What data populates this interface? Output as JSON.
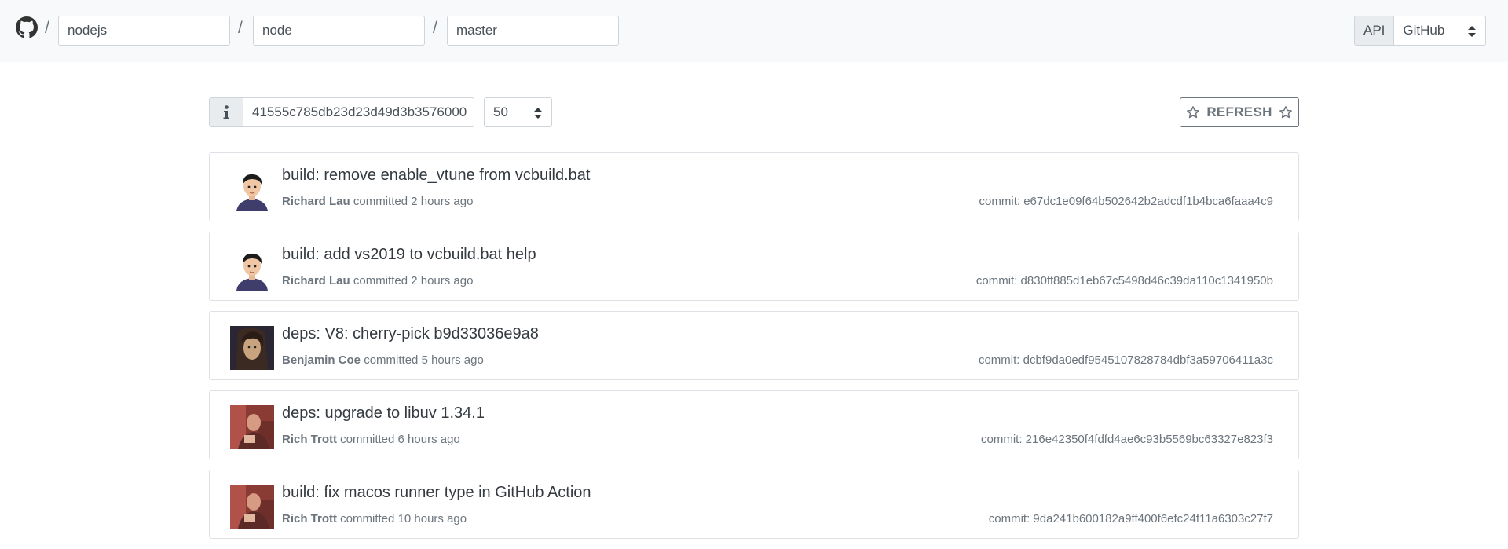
{
  "header": {
    "owner": "nodejs",
    "repo": "node",
    "branch": "master",
    "separator": "/",
    "api_label": "API",
    "api_selected": "GitHub"
  },
  "controls": {
    "sha_value": "41555c785db23d23d49d3b3576000",
    "count_selected": "50",
    "refresh_label": "REFRESH"
  },
  "commits": [
    {
      "message": "build: remove enable_vtune from vcbuild.bat",
      "author": "Richard Lau",
      "verb": "committed",
      "time": "2 hours ago",
      "sha_label": "commit: e67dc1e09f64b502642b2adcdf1b4bca6faaa4c9",
      "avatar": "cartoon"
    },
    {
      "message": "build: add vs2019 to vcbuild.bat help",
      "author": "Richard Lau",
      "verb": "committed",
      "time": "2 hours ago",
      "sha_label": "commit: d830ff885d1eb67c5498d46c39da110c1341950b",
      "avatar": "cartoon"
    },
    {
      "message": "deps: V8: cherry-pick b9d33036e9a8",
      "author": "Benjamin Coe",
      "verb": "committed",
      "time": "5 hours ago",
      "sha_label": "commit: dcbf9da0edf9545107828784dbf3a59706411a3c",
      "avatar": "portrait"
    },
    {
      "message": "deps: upgrade to libuv 1.34.1",
      "author": "Rich Trott",
      "verb": "committed",
      "time": "6 hours ago",
      "sha_label": "commit: 216e42350f4fdfd4ae6c93b5569bc63327e823f3",
      "avatar": "photo-red"
    },
    {
      "message": "build: fix macos runner type in GitHub Action",
      "author": "Rich Trott",
      "verb": "committed",
      "time": "10 hours ago",
      "sha_label": "commit: 9da241b600182a9ff400f6efc24f11a6303c27f7",
      "avatar": "photo-red"
    }
  ]
}
